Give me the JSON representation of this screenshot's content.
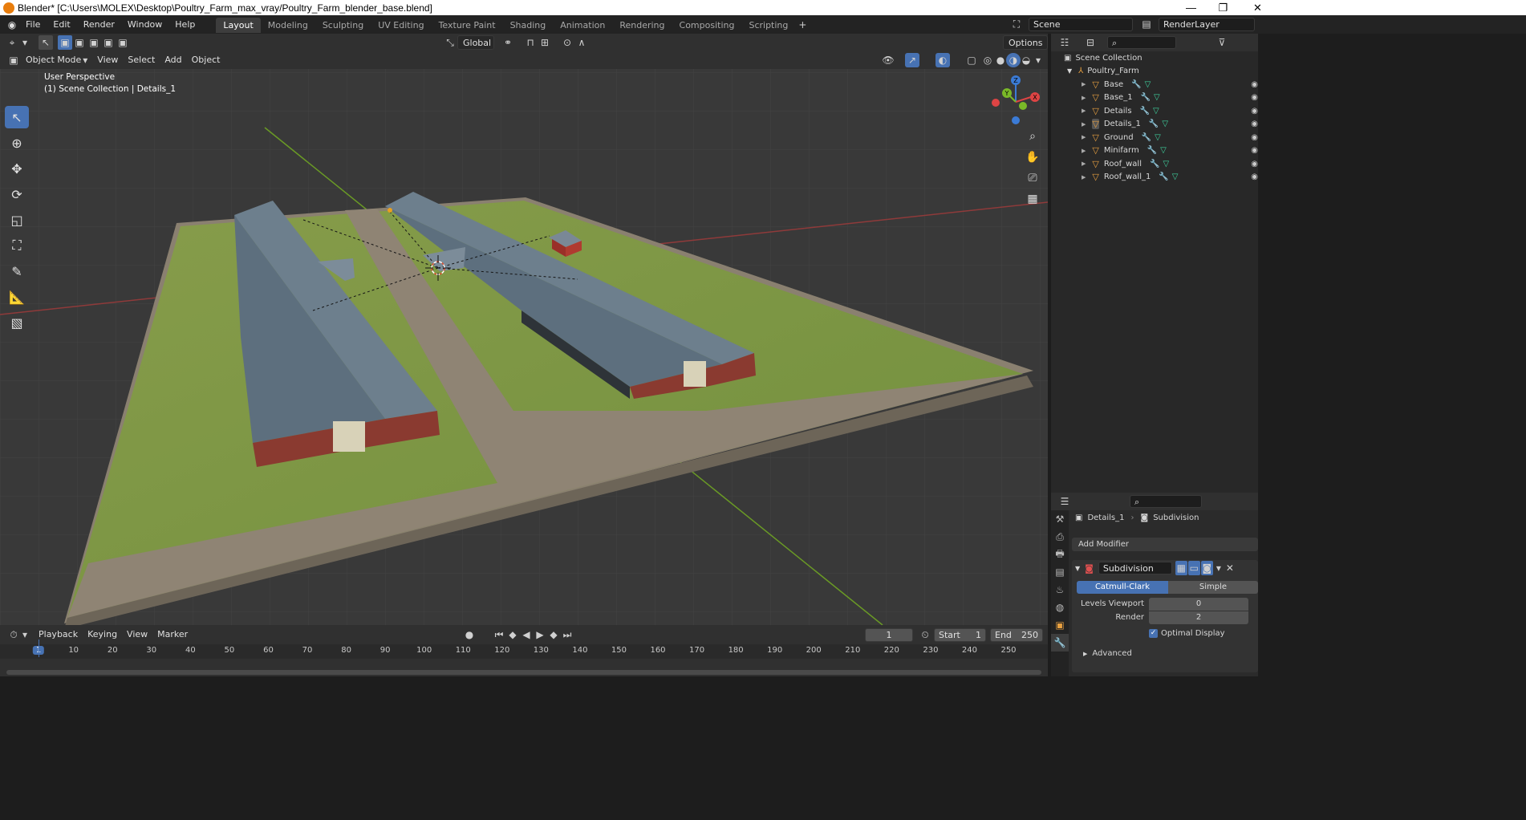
{
  "window": {
    "title": "Blender* [C:\\Users\\MOLEX\\Desktop\\Poultry_Farm_max_vray/Poultry_Farm_blender_base.blend]",
    "minimize": "—",
    "maximize": "❐",
    "close": "✕"
  },
  "menus": [
    "File",
    "Edit",
    "Render",
    "Window",
    "Help"
  ],
  "workspaces": [
    "Layout",
    "Modeling",
    "Sculpting",
    "UV Editing",
    "Texture Paint",
    "Shading",
    "Animation",
    "Rendering",
    "Compositing",
    "Scripting"
  ],
  "active_workspace": "Layout",
  "scene": {
    "name": "Scene",
    "render_layer": "RenderLayer"
  },
  "viewport": {
    "transform_orientation": "Global",
    "options_label": "Options",
    "mode": "Object Mode",
    "menu": [
      "View",
      "Select",
      "Add",
      "Object"
    ],
    "overlay_line1": "User Perspective",
    "overlay_line2": "(1) Scene Collection | Details_1",
    "gizmo": {
      "z": "Z",
      "y": "Y",
      "x": "X"
    },
    "colors": {
      "grass": "#7b9a3e",
      "roof": "#5d6f7e",
      "wall": "#8a3a30",
      "dirt": "#8c8070",
      "grid_bg": "#393939",
      "x_axis": "#9c3a3a",
      "y_axis": "#6f9a2a"
    }
  },
  "timeline": {
    "menus": [
      "Playback",
      "Keying",
      "View",
      "Marker"
    ],
    "current_frame": "1",
    "start_label": "Start",
    "start": "1",
    "end_label": "End",
    "end": "250",
    "ticks": [
      "1",
      "10",
      "20",
      "30",
      "40",
      "50",
      "60",
      "70",
      "80",
      "90",
      "100",
      "110",
      "120",
      "130",
      "140",
      "150",
      "160",
      "170",
      "180",
      "190",
      "200",
      "210",
      "220",
      "230",
      "240",
      "250"
    ]
  },
  "outliner": {
    "root": "Scene Collection",
    "parent": "Poultry_Farm",
    "items": [
      "Base",
      "Base_1",
      "Details",
      "Details_1",
      "Ground",
      "Minifarm",
      "Roof_wall",
      "Roof_wall_1"
    ],
    "active_item": "Details_1"
  },
  "properties": {
    "object": "Details_1",
    "modifier_name": "Subdivision",
    "add_modifier": "Add Modifier",
    "mod_type_a": "Catmull-Clark",
    "mod_type_b": "Simple",
    "levels_viewport_label": "Levels Viewport",
    "levels_viewport": "0",
    "render_label": "Render",
    "render": "2",
    "optimal_display": "Optimal Display",
    "advanced": "Advanced"
  }
}
